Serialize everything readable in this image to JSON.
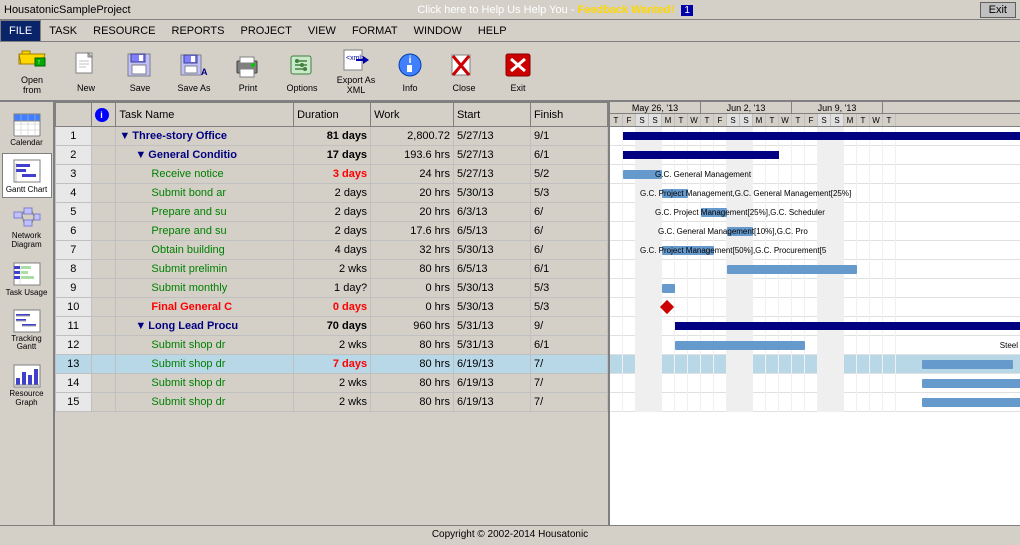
{
  "titleBar": {
    "title": "HousatonicSampleProject",
    "feedbackText": "Click here to Help Us Help You - Feedback Wanted!",
    "infoBadge": "1",
    "exitLabel": "Exit"
  },
  "menuBar": {
    "items": [
      {
        "label": "FILE",
        "active": true
      },
      {
        "label": "TASK",
        "active": false
      },
      {
        "label": "RESOURCE",
        "active": false
      },
      {
        "label": "REPORTS",
        "active": false
      },
      {
        "label": "PROJECT",
        "active": false
      },
      {
        "label": "VIEW",
        "active": false
      },
      {
        "label": "FORMAT",
        "active": false
      },
      {
        "label": "WINDOW",
        "active": false
      },
      {
        "label": "HELP",
        "active": false
      }
    ]
  },
  "toolbar": {
    "buttons": [
      {
        "id": "open",
        "label": "Open\nfrom",
        "icon": "folder-open"
      },
      {
        "id": "new",
        "label": "New",
        "icon": "new-doc"
      },
      {
        "id": "save",
        "label": "Save",
        "icon": "save"
      },
      {
        "id": "saveas",
        "label": "Save As",
        "icon": "save-as"
      },
      {
        "id": "print",
        "label": "Print",
        "icon": "print"
      },
      {
        "id": "options",
        "label": "Options",
        "icon": "options"
      },
      {
        "id": "exportxml",
        "label": "Export As\nXML",
        "icon": "export"
      },
      {
        "id": "info",
        "label": "Info",
        "icon": "info"
      },
      {
        "id": "close",
        "label": "Close",
        "icon": "close"
      },
      {
        "id": "exit",
        "label": "Exit",
        "icon": "exit"
      }
    ]
  },
  "sidebar": {
    "items": [
      {
        "id": "calendar",
        "label": "Calendar",
        "icon": "calendar"
      },
      {
        "id": "gantt",
        "label": "Gantt Chart",
        "icon": "gantt",
        "active": true
      },
      {
        "id": "network",
        "label": "Network\nDiagram",
        "icon": "network"
      },
      {
        "id": "taskusage",
        "label": "Task Usage",
        "icon": "taskusage"
      },
      {
        "id": "tracking",
        "label": "Tracking\nGantt",
        "icon": "tracking"
      },
      {
        "id": "resource",
        "label": "Resource\nGraph",
        "icon": "resource"
      }
    ]
  },
  "tableHeader": {
    "infoLabel": "i",
    "nameLabel": "Task Name",
    "durationLabel": "Duration",
    "workLabel": "Work",
    "startLabel": "Start",
    "finishLabel": "Finish"
  },
  "tasks": [
    {
      "id": 1,
      "level": 0,
      "type": "summary",
      "name": "Three-story Office",
      "duration": "81 days",
      "work": "2,800.72",
      "start": "5/27/13",
      "finish": "9/1",
      "indent": 0,
      "expand": true
    },
    {
      "id": 2,
      "level": 1,
      "type": "summary",
      "name": "General Conditio",
      "duration": "17 days",
      "work": "193.6 hrs",
      "start": "5/27/13",
      "finish": "6/1",
      "indent": 1,
      "expand": true
    },
    {
      "id": 3,
      "level": 2,
      "type": "task",
      "name": "Receive notice",
      "duration": "3 days",
      "work": "24 hrs",
      "start": "5/27/13",
      "finish": "5/2",
      "indent": 2,
      "highlight": true
    },
    {
      "id": 4,
      "level": 2,
      "type": "task",
      "name": "Submit bond ar",
      "duration": "2 days",
      "work": "20 hrs",
      "start": "5/30/13",
      "finish": "5/3",
      "indent": 2
    },
    {
      "id": 5,
      "level": 2,
      "type": "task",
      "name": "Prepare and su",
      "duration": "2 days",
      "work": "20 hrs",
      "start": "6/3/13",
      "finish": "6/",
      "indent": 2
    },
    {
      "id": 6,
      "level": 2,
      "type": "task",
      "name": "Prepare and su",
      "duration": "2 days",
      "work": "17.6 hrs",
      "start": "6/5/13",
      "finish": "6/",
      "indent": 2
    },
    {
      "id": 7,
      "level": 2,
      "type": "task",
      "name": "Obtain building",
      "duration": "4 days",
      "work": "32 hrs",
      "start": "5/30/13",
      "finish": "6/",
      "indent": 2
    },
    {
      "id": 8,
      "level": 2,
      "type": "task",
      "name": "Submit prelimin",
      "duration": "2 wks",
      "work": "80 hrs",
      "start": "6/5/13",
      "finish": "6/1",
      "indent": 2
    },
    {
      "id": 9,
      "level": 2,
      "type": "task",
      "name": "Submit monthly",
      "duration": "1 day?",
      "work": "0 hrs",
      "start": "5/30/13",
      "finish": "5/3",
      "indent": 2
    },
    {
      "id": 10,
      "level": 2,
      "type": "milestone",
      "name": "Final General C",
      "duration": "0 days",
      "work": "0 hrs",
      "start": "5/30/13",
      "finish": "5/3",
      "indent": 2
    },
    {
      "id": 11,
      "level": 1,
      "type": "summary",
      "name": "Long Lead Procu",
      "duration": "70 days",
      "work": "960 hrs",
      "start": "5/31/13",
      "finish": "9/",
      "indent": 1,
      "expand": true
    },
    {
      "id": 12,
      "level": 2,
      "type": "task",
      "name": "Submit shop dr",
      "duration": "2 wks",
      "work": "80 hrs",
      "start": "5/31/13",
      "finish": "6/1",
      "indent": 2
    },
    {
      "id": 13,
      "level": 2,
      "type": "task",
      "name": "Submit shop dr",
      "duration": "7 days",
      "work": "80 hrs",
      "start": "6/19/13",
      "finish": "7/",
      "indent": 2,
      "selected": true,
      "highlight": true
    },
    {
      "id": 14,
      "level": 2,
      "type": "task",
      "name": "Submit shop dr",
      "duration": "2 wks",
      "work": "80 hrs",
      "start": "6/19/13",
      "finish": "7/",
      "indent": 2
    },
    {
      "id": 15,
      "level": 2,
      "type": "task",
      "name": "Submit shop dr",
      "duration": "2 wks",
      "work": "80 hrs",
      "start": "6/19/13",
      "finish": "7/",
      "indent": 2
    }
  ],
  "ganttHeader": {
    "weeks": [
      {
        "label": "May 26, '13",
        "days": 7
      },
      {
        "label": "Jun 2, '13",
        "days": 7
      },
      {
        "label": "Jun 9, '13",
        "days": 7
      }
    ],
    "dayLabels": [
      "T",
      "F",
      "S",
      "S",
      "M",
      "T",
      "W",
      "T",
      "F",
      "S",
      "S",
      "M",
      "T",
      "W",
      "T",
      "F",
      "S",
      "S",
      "M",
      "T",
      "W",
      "T"
    ]
  },
  "footer": {
    "copyright": "Copyright © 2002-2014 Housatonic"
  }
}
